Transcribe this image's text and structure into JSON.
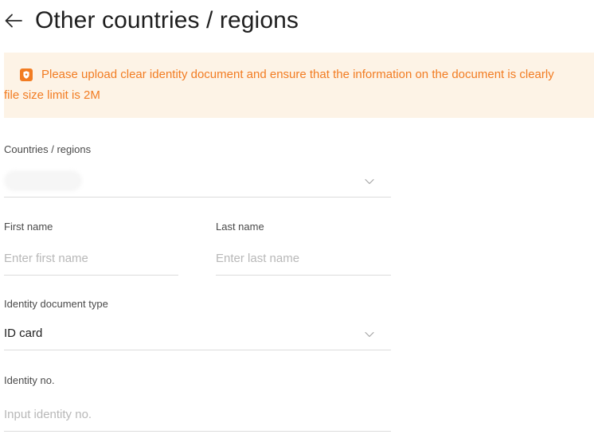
{
  "header": {
    "back_icon": "arrow-left-icon",
    "title": "Other countries / regions"
  },
  "notice": {
    "icon": "shield-lock-icon",
    "line1": "Please upload clear identity document and ensure that the information on the document is clearly",
    "line2": "file size limit is 2M",
    "colors": {
      "background": "#fdf3e6",
      "text": "#f27c22"
    }
  },
  "form": {
    "country": {
      "label": "Countries / regions",
      "value": "",
      "icon": "chevron-down-icon"
    },
    "first_name": {
      "label": "First name",
      "placeholder": "Enter first name"
    },
    "last_name": {
      "label": "Last name",
      "placeholder": "Enter last name"
    },
    "document_type": {
      "label": "Identity document type",
      "value": "ID card",
      "icon": "chevron-down-icon"
    },
    "identity_no": {
      "label": "Identity no.",
      "placeholder": "Input identity no."
    }
  }
}
